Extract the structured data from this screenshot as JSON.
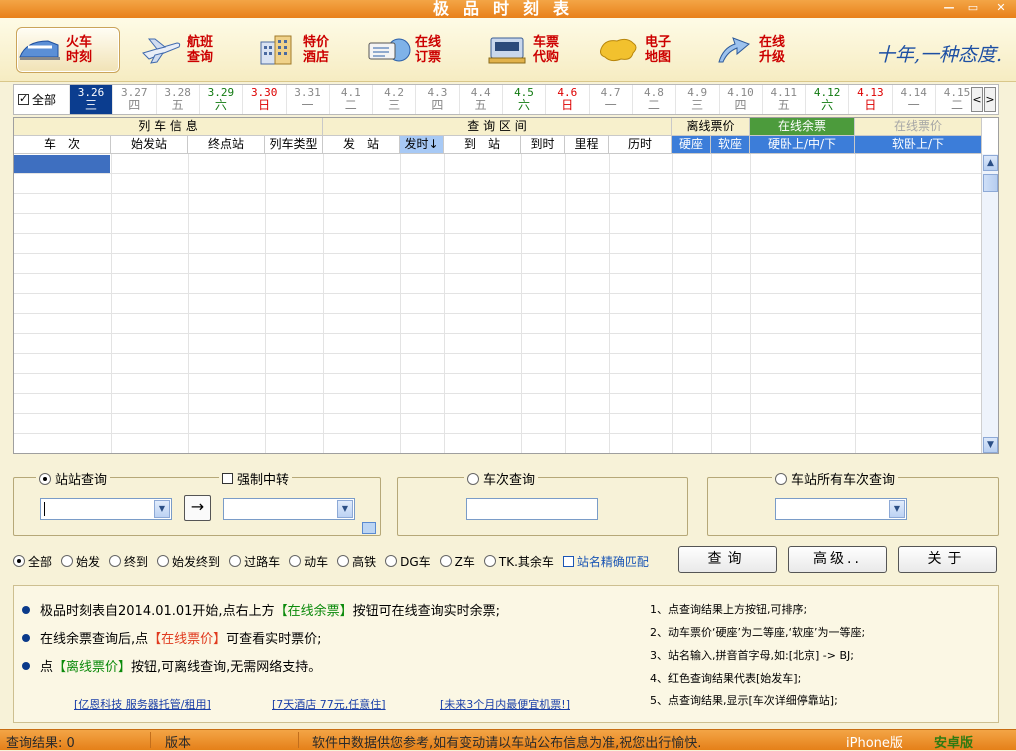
{
  "window": {
    "title": "极品时刻表",
    "min": "—",
    "max": "▭",
    "close": "✕"
  },
  "toolbar": [
    {
      "name": "train-timetable",
      "line1": "火车",
      "line2": "时刻"
    },
    {
      "name": "flight-query",
      "line1": "航班",
      "line2": "查询"
    },
    {
      "name": "hotel-deals",
      "line1": "特价",
      "line2": "酒店"
    },
    {
      "name": "online-booking",
      "line1": "在线",
      "line2": "订票"
    },
    {
      "name": "ticket-agent",
      "line1": "车票",
      "line2": "代购"
    },
    {
      "name": "e-map",
      "line1": "电子",
      "line2": "地图"
    },
    {
      "name": "online-upgrade",
      "line1": "在线",
      "line2": "升级"
    }
  ],
  "slogan": "十年,一种态度.",
  "datebar": {
    "all_label": "全部",
    "dates": [
      {
        "d": "3.26",
        "w": "三",
        "kind": "sel"
      },
      {
        "d": "3.27",
        "w": "四",
        "kind": ""
      },
      {
        "d": "3.28",
        "w": "五",
        "kind": ""
      },
      {
        "d": "3.29",
        "w": "六",
        "kind": "sat"
      },
      {
        "d": "3.30",
        "w": "日",
        "kind": "sun"
      },
      {
        "d": "3.31",
        "w": "一",
        "kind": ""
      },
      {
        "d": "4.1",
        "w": "二",
        "kind": ""
      },
      {
        "d": "4.2",
        "w": "三",
        "kind": ""
      },
      {
        "d": "4.3",
        "w": "四",
        "kind": ""
      },
      {
        "d": "4.4",
        "w": "五",
        "kind": ""
      },
      {
        "d": "4.5",
        "w": "六",
        "kind": "sat"
      },
      {
        "d": "4.6",
        "w": "日",
        "kind": "sun"
      },
      {
        "d": "4.7",
        "w": "一",
        "kind": ""
      },
      {
        "d": "4.8",
        "w": "二",
        "kind": ""
      },
      {
        "d": "4.9",
        "w": "三",
        "kind": ""
      },
      {
        "d": "4.10",
        "w": "四",
        "kind": ""
      },
      {
        "d": "4.11",
        "w": "五",
        "kind": ""
      },
      {
        "d": "4.12",
        "w": "六",
        "kind": "sat"
      },
      {
        "d": "4.13",
        "w": "日",
        "kind": "sun"
      },
      {
        "d": "4.14",
        "w": "一",
        "kind": ""
      },
      {
        "d": "4.15",
        "w": "二",
        "kind": ""
      }
    ],
    "prev": "<",
    "next": ">"
  },
  "grid": {
    "group_train": "列 车 信 息",
    "group_query": "查 询 区 间",
    "group_offline": "离线票价",
    "group_remaining": "在线余票",
    "group_online_price": "在线票价",
    "columns": [
      "车　次",
      "始发站",
      "终点站",
      "列车类型",
      "发　站",
      "发时↓",
      "到　站",
      "到时",
      "里程",
      "历时",
      "硬座",
      "软座",
      "硬卧上/中/下",
      "软卧上/下"
    ]
  },
  "search": {
    "station_query": "站站查询",
    "force_transfer": "强制中转",
    "train_query": "车次查询",
    "all_trains_query": "车站所有车次查询",
    "swap": "→"
  },
  "filters": [
    "全部",
    "始发",
    "终到",
    "始发终到",
    "过路车",
    "动车",
    "高铁",
    "DG车",
    "Z车",
    "TK.其余车"
  ],
  "exact_match": "站名精确匹配",
  "buttons": {
    "query": "查询",
    "advanced": "高级..",
    "about": "关于"
  },
  "info": {
    "b1_pre": "极品时刻表自2014.01.01开始,点右上方",
    "b1_hl": "【在线余票】",
    "b1_post": "按钮可在线查询实时余票;",
    "b2_pre": "在线余票查询后,点",
    "b2_hl": "【在线票价】",
    "b2_post": "可查看实时票价;",
    "b3_pre": "点",
    "b3_hl": "【离线票价】",
    "b3_post": "按钮,可离线查询,无需网络支持。",
    "tips": [
      "1、点查询结果上方按钮,可排序;",
      "2、动车票价‘硬座’为二等座,‘软座’为一等座;",
      "3、站名输入,拼音首字母,如:[北京] -> BJ;",
      "4、红色查询结果代表[始发车];",
      "5、点查询结果,显示[车次详细停靠站];"
    ],
    "links": [
      "[亿恩科技 服务器托管/租用]",
      "[7天酒店 77元,任意住]",
      "[未来3个月内最便宜机票!]"
    ]
  },
  "status": {
    "result": "查询结果: 0",
    "version": "版本",
    "notice": "软件中数据供您参考,如有变动请以车站公布信息为准,祝您出行愉快.",
    "iphone": "iPhone版",
    "android": "安卓版"
  }
}
